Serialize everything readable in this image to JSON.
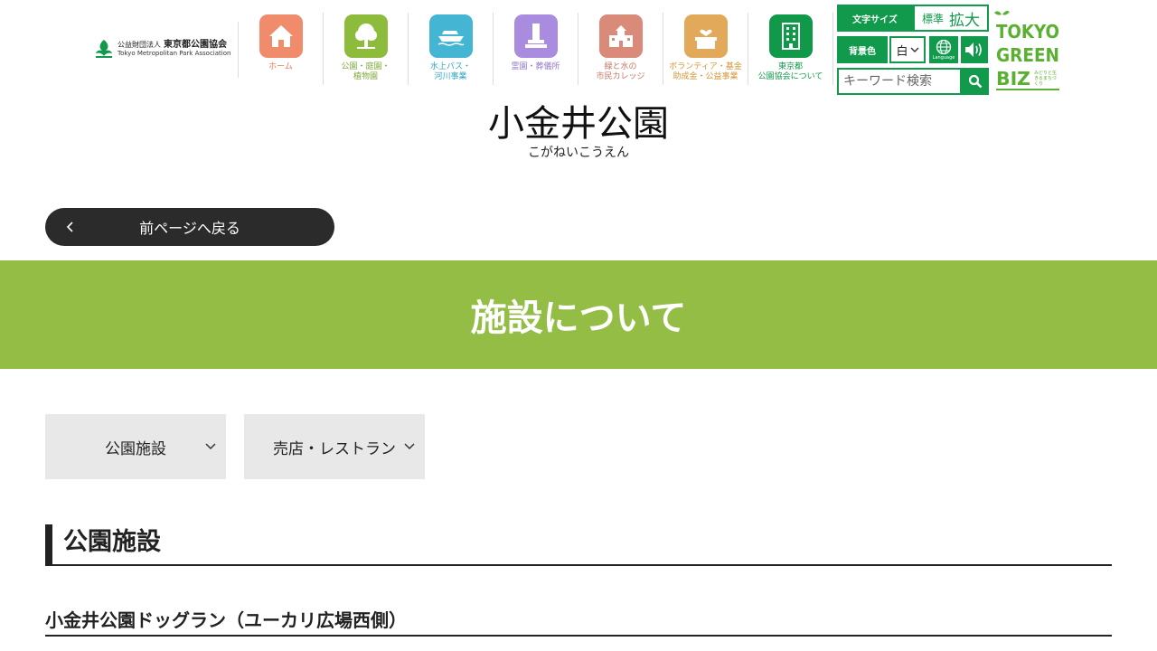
{
  "logo": {
    "prefix": "公益財団法人",
    "name_jp": "東京都公園協会",
    "name_en": "Tokyo Metropolitan Park Association"
  },
  "nav": [
    {
      "label": "ホーム",
      "color": "#f08c6c",
      "label_color": "#e8794f",
      "icon": "home-icon"
    },
    {
      "label": "公園・庭園・\n植物園",
      "color": "#8dbb3c",
      "label_color": "#7ea83a",
      "icon": "tree-icon"
    },
    {
      "label": "水上バス・\n河川事業",
      "color": "#44b6d4",
      "label_color": "#2fa3c6",
      "icon": "boat-icon"
    },
    {
      "label": "霊園・葬儀所",
      "color": "#a98ce0",
      "label_color": "#9277cc",
      "icon": "monument-icon"
    },
    {
      "label": "緑と水の\n市民カレッジ",
      "color": "#d98a78",
      "label_color": "#c97663",
      "icon": "school-icon"
    },
    {
      "label": "ボランティア・基金\n助成金・公益事業",
      "color": "#e2a95a",
      "label_color": "#d69530",
      "icon": "heart-box-icon"
    },
    {
      "label": "東京都\n公園協会について",
      "color": "#11994a",
      "label_color": "#11994a",
      "icon": "building-icon"
    }
  ],
  "tools": {
    "font_size_label": "文字サイズ",
    "font_std": "標準",
    "font_big": "拡大",
    "bg_label": "背景色",
    "bg_value": "白",
    "language_label": "Language",
    "search_placeholder": "キーワード検索"
  },
  "tgb_logo": {
    "line1": "TOKYO",
    "line2": "GREEN",
    "line3": "BIZ",
    "tagline": "みどりと生きるまちづくり"
  },
  "page": {
    "title": "小金井公園",
    "ruby": "こがねいこうえん",
    "back_label": "前ページへ戻る",
    "band_title": "施設について"
  },
  "tabs": [
    {
      "label": "公園施設"
    },
    {
      "label": "売店・レストラン"
    }
  ],
  "section": {
    "heading": "公園施設",
    "sub_heading": "小金井公園ドッグラン（ユーカリ広場西側）"
  },
  "colors": {
    "brand_green": "#119a4b",
    "band_green": "#94bd45",
    "dark": "#2b2b2b",
    "tab_bg": "#e8e8e8"
  }
}
